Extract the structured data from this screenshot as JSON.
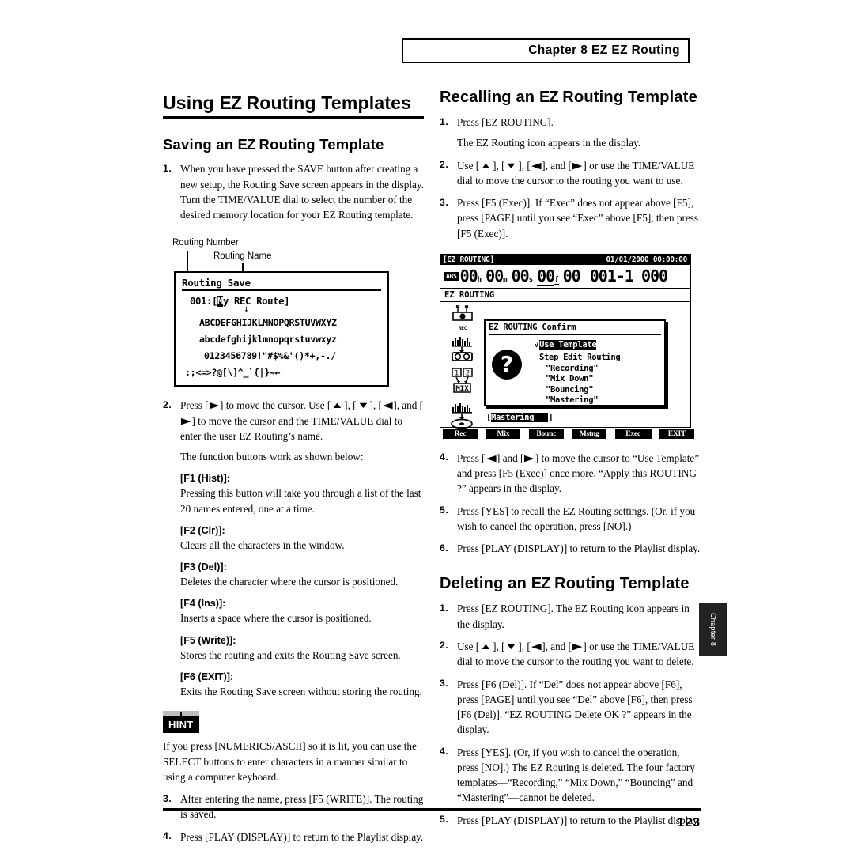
{
  "header": {
    "chapter_label": "Chapter 8",
    "chapter_topic": "EZ Routing"
  },
  "left": {
    "title_pre": "Using ",
    "title_ez": "EZ",
    "title_post": " Routing Templates",
    "subtitle_pre": "Saving an ",
    "subtitle_ez": "EZ",
    "subtitle_post": " Routing Template",
    "step1_num": "1.",
    "step1_text": "When you have pressed the SAVE button after creating a new setup, the Routing Save screen appears in the display. Turn the TIME/VALUE dial to select the number of the desired memory location for your EZ Routing template.",
    "callout_number": "Routing Number",
    "callout_name": "Routing Name",
    "step2_num": "2.",
    "step2_a": "Press [",
    "step2_b": "] to move the cursor. Use [",
    "step2_c": "], [",
    "step2_d": "], [",
    "step2_e": "], and [",
    "step2_f": "] to move the cursor and the TIME/VALUE dial to enter the user EZ Routing’s name.",
    "step2_note": "The function buttons work as shown below:",
    "defs": [
      {
        "term": "[F1 (Hist)]:",
        "body": "Pressing this button will take you through a list of the last 20 names entered, one at a time."
      },
      {
        "term": "[F2 (Clr)]:",
        "body": "Clears all the characters in the window."
      },
      {
        "term": "[F3 (Del)]:",
        "body": "Deletes the character where the cursor is positioned."
      },
      {
        "term": "[F4 (Ins)]:",
        "body": "Inserts a space where the cursor is positioned."
      },
      {
        "term": "[F5 (Write)]:",
        "body": "Stores the routing and exits the Routing Save screen."
      },
      {
        "term": "[F6 (EXIT)]:",
        "body": "Exits the Routing Save screen without storing the routing."
      }
    ],
    "hint_label": "HINT",
    "hint_body": "If you press [NUMERICS/ASCII] so it is lit, you can use the SELECT buttons to enter characters in a manner similar to using a computer keyboard.",
    "step3_num": "3.",
    "step3_text": "After entering the name, press [F5 (WRITE)]. The routing is saved.",
    "step4_num": "4.",
    "step4_text": "Press [PLAY (DISPLAY)] to return to the Playlist display."
  },
  "lcd_save": {
    "title": "Routing Save",
    "number": "001:",
    "bracket_open": "[",
    "cursor_char": "M",
    "name_rest": "y REC Route",
    "bracket_close": "]",
    "down_arrow": "↓",
    "row_upper": "ABCDEFGHIJKLMNOPQRSTUVWXYZ",
    "row_lower": "abcdefghijklmnopqrstuvwxyz",
    "row_digits": "0123456789!\"#$%&'()*+,-./",
    "row_symbols": ":;<=>?@[\\]^_`{|}→←"
  },
  "right": {
    "title_pre": "Recalling an ",
    "title_ez": "EZ",
    "title_post": " Routing Template",
    "steps": [
      {
        "num": "1.",
        "text": "Press [EZ ROUTING]."
      },
      {
        "num": "",
        "text": "The EZ Routing icon appears in the display."
      }
    ],
    "step1_num": "1.",
    "step1_text": "Press [EZ ROUTING].",
    "step1_sub": "The EZ Routing icon appears in the display.",
    "step2_num": "2.",
    "step2_a": "Use [",
    "step2_b": "], [",
    "step2_c": "], [",
    "step2_d": "], and [",
    "step2_e": "] or use the TIME/VALUE dial to move the cursor to the routing you want to use.",
    "step3_num": "3.",
    "step3_text": "Press [F5 (Exec)]. If “Exec” does not appear above [F5], press [PAGE] until you see “Exec” above [F5], then press [F5 (Exec)].",
    "step4_num": "4.",
    "step4_a": "Press [",
    "step4_b": "] and [",
    "step4_c": "] to move the cursor to “Use Template” and press [F5 (Exec)] once more. “Apply this ROUTING ?” appears in the display.",
    "step5_num": "5.",
    "step5_text": "Press [YES] to recall the EZ Routing settings. (Or, if you wish to cancel the operation, press [NO].)",
    "step6_num": "6.",
    "step6_text": "Press [PLAY (DISPLAY)] to return to the Playlist display.",
    "del_title_pre": "Deleting an ",
    "del_title_ez": "EZ",
    "del_title_post": " Routing Template",
    "del1_num": "1.",
    "del1_text": "Press [EZ ROUTING]. The EZ Routing icon appears in the display.",
    "del2_num": "2.",
    "del2_a": "Use [",
    "del2_b": "], [",
    "del2_c": "], [",
    "del2_d": "], and [",
    "del2_e": "] or use the TIME/VALUE dial to move the cursor to the routing you want to delete.",
    "del3_num": "3.",
    "del3_text": "Press [F6 (Del)]. If “Del” does not appear above [F6], press [PAGE] until you see “Del” above [F6], then press [F6 (Del)]. “EZ ROUTING Delete OK ?” appears in the display.",
    "del4_num": "4.",
    "del4_text": "Press [YES]. (Or, if you wish to cancel the operation, press [NO].) The EZ Routing is deleted. The four factory templates—“Recording,” “Mix Down,” “Bouncing” and “Mastering”—cannot be deleted.",
    "del5_num": "5.",
    "del5_text": "Press [PLAY (DISPLAY)] to return to the Playlist display."
  },
  "lcd_ez": {
    "titlebar_left": "[EZ ROUTING]",
    "titlebar_right": "01/01/2000 00:00:00",
    "abs": "ABS",
    "h": "00",
    "h_u": "h",
    "m": "00",
    "m_u": "m",
    "s": "00",
    "s_u": "s",
    "f": "00",
    "f_u": "f",
    "sub": "00",
    "measure": "001-1",
    "tick": "000",
    "mode_label": "EZ ROUTING",
    "icons": [
      {
        "name": "rec-icon",
        "label": "REC"
      },
      {
        "name": "track-to-track-icon",
        "label": ""
      },
      {
        "name": "mix-icon",
        "label": "MIX"
      },
      {
        "name": "mastering-icon",
        "label": ""
      }
    ],
    "dialog_title": "EZ ROUTING Confirm",
    "dialog_check": "√",
    "dialog_selected": "Use Template",
    "dialog_option2": "Step Edit Routing",
    "dialog_items": [
      "\"Recording\"",
      "\"Mix Down\"",
      "\"Bouncing\"",
      "\"Mastering\""
    ],
    "field_open": "[",
    "field_value": "Mastering",
    "field_close": "]",
    "fkeys": [
      {
        "label": "Rec",
        "selected": false
      },
      {
        "label": "Mix",
        "selected": false
      },
      {
        "label": "Bounc",
        "selected": false
      },
      {
        "label": "Mstng",
        "selected": false
      },
      {
        "label": "Exec",
        "selected": true
      },
      {
        "label": "EXIT",
        "selected": false
      }
    ]
  },
  "footer": {
    "page_number": "123",
    "tab_label": "Chapter 8"
  }
}
